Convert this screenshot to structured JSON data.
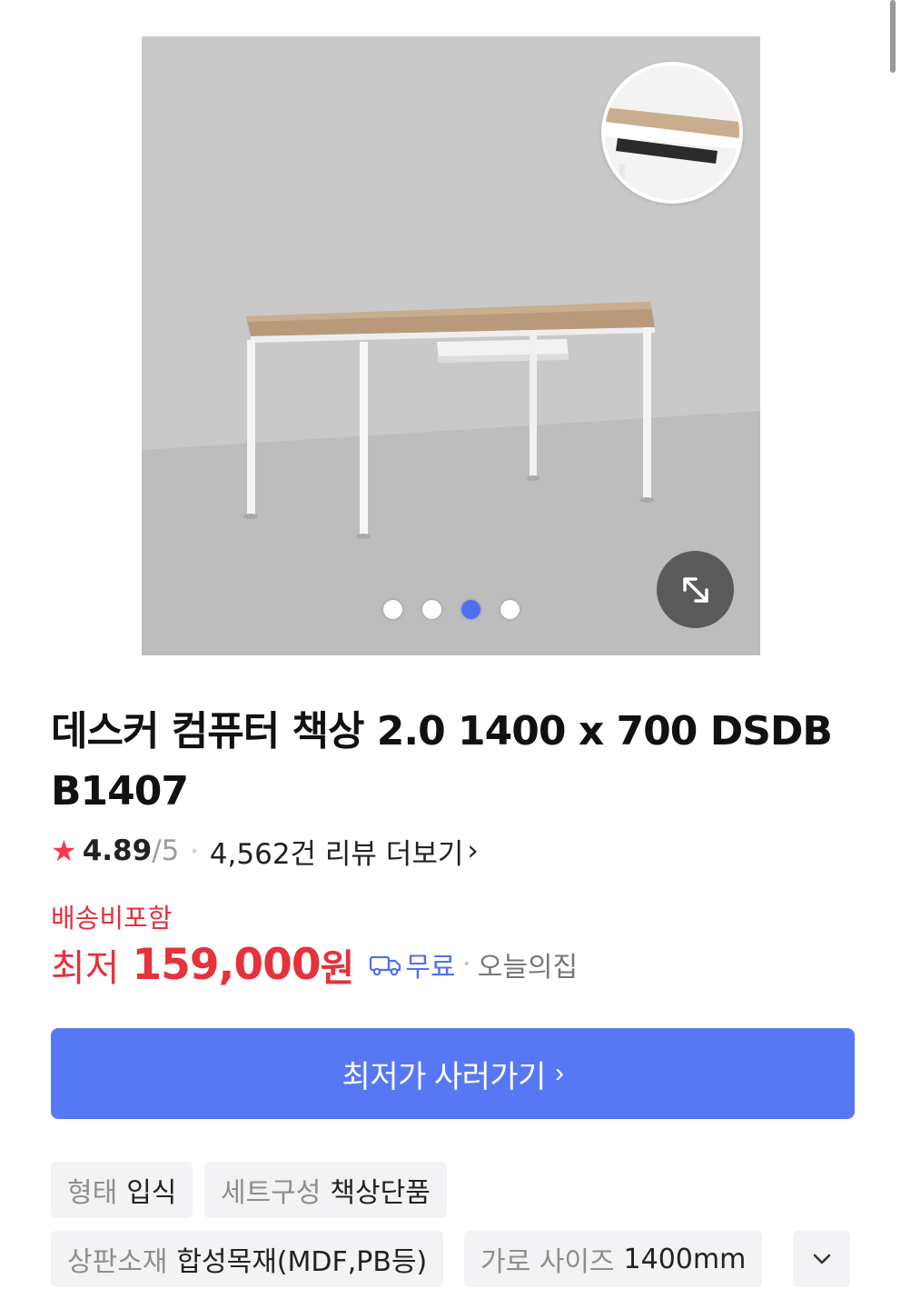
{
  "product": {
    "title": "데스커 컴퓨터 책상 2.0 1400 x 700 DSDB B1407",
    "image_count": 4,
    "active_image_index": 2
  },
  "rating": {
    "value": "4.89",
    "scale": "/5",
    "review_link": "4,562건 리뷰 더보기"
  },
  "price": {
    "shipping_note": "배송비포함",
    "prefix": "최저",
    "amount": "159,000",
    "unit": "원",
    "delivery": "무료",
    "mall": "오늘의집"
  },
  "cta": {
    "label": "최저가 사러가기"
  },
  "specs": [
    {
      "key": "형태",
      "value": "입식"
    },
    {
      "key": "세트구성",
      "value": "책상단품"
    },
    {
      "key": "상판소재",
      "value": "합성목재(MDF,PB등)"
    },
    {
      "key": "가로 사이즈",
      "value": "1400mm"
    }
  ],
  "colors": {
    "accent": "#5678f5",
    "price_red": "#e5323b",
    "star": "#f2394d"
  },
  "icons": [
    "star-icon",
    "truck-icon",
    "expand-icon",
    "chevron-right-icon",
    "chevron-down-icon"
  ]
}
